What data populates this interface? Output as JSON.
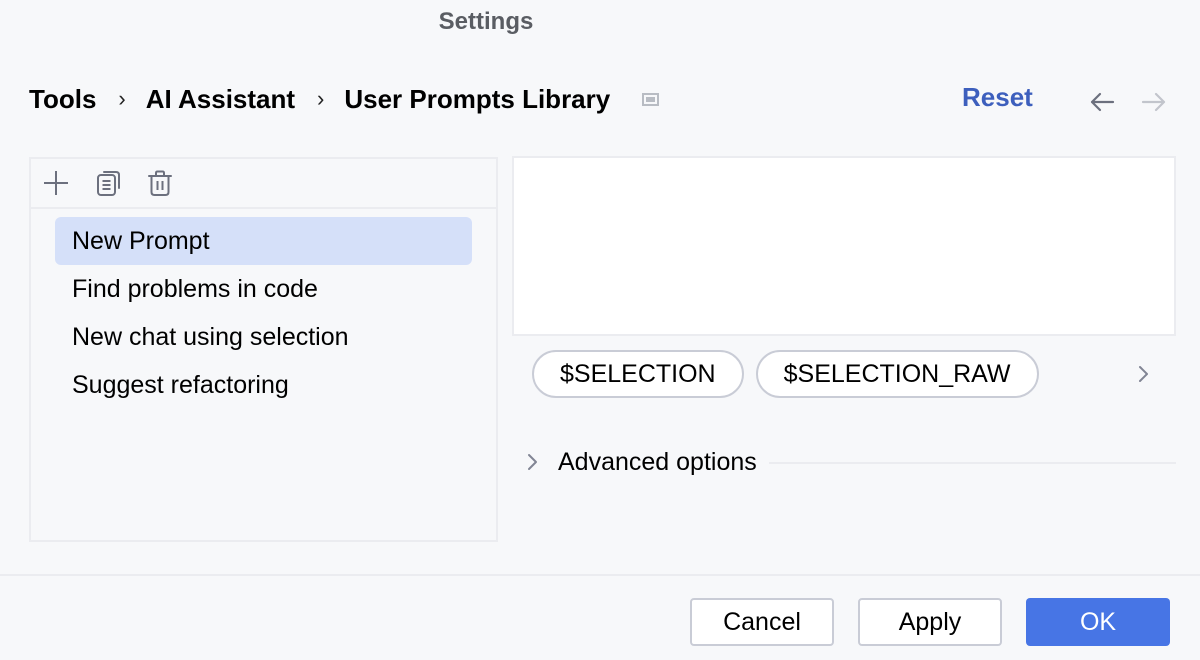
{
  "window": {
    "title": "Settings"
  },
  "breadcrumb": {
    "items": [
      "Tools",
      "AI Assistant",
      "User Prompts Library"
    ],
    "separator": "›",
    "icon": "window-icon"
  },
  "header": {
    "reset_label": "Reset",
    "back_icon": "arrow-left-icon",
    "forward_icon": "arrow-right-icon"
  },
  "toolbar": {
    "add_icon": "plus-icon",
    "copy_icon": "copy-icon",
    "delete_icon": "trash-icon"
  },
  "prompts": {
    "selected_index": 0,
    "items": [
      {
        "label": "New Prompt"
      },
      {
        "label": "Find problems in code"
      },
      {
        "label": "New chat using selection"
      },
      {
        "label": "Suggest refactoring"
      }
    ]
  },
  "editor": {
    "value": ""
  },
  "variables": {
    "chips": [
      "$SELECTION",
      "$SELECTION_RAW"
    ],
    "more_icon": "chevron-right-icon"
  },
  "advanced": {
    "label": "Advanced options",
    "expanded": false
  },
  "footer": {
    "cancel_label": "Cancel",
    "apply_label": "Apply",
    "ok_label": "OK"
  },
  "colors": {
    "accent": "#4775e5",
    "link": "#3d5fbd",
    "selection": "#d5e0f9",
    "background": "#f7f8fa",
    "border": "#ebecf0"
  }
}
